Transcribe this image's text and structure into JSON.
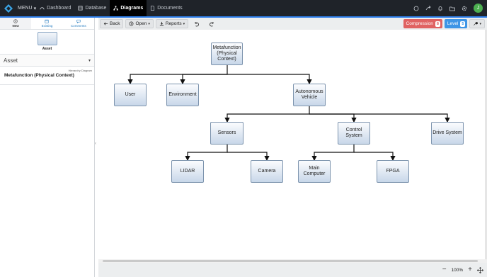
{
  "topbar": {
    "menu_label": "MENU",
    "nav": [
      {
        "label": "Dashboard"
      },
      {
        "label": "Database"
      },
      {
        "label": "Diagrams"
      },
      {
        "label": "Documents"
      }
    ],
    "avatar_initial": "J",
    "icons": [
      "chat-icon",
      "share-icon",
      "bell-icon",
      "folder-icon",
      "gear-icon"
    ]
  },
  "left_panel": {
    "tabs": [
      {
        "label": "New"
      },
      {
        "label": "Existing"
      },
      {
        "label": "Comments"
      }
    ],
    "asset_caption": "Asset",
    "asset_select_value": "Asset",
    "hierarchy_label": "Hierarchy Diagram",
    "diagram_title": "Metafunction (Physical Context)"
  },
  "toolbar": {
    "back_label": "Back",
    "open_label": "Open",
    "reports_label": "Reports",
    "compression_label": "Compression",
    "compression_count": "8",
    "level_label": "Level",
    "level_count": "5"
  },
  "diagram": {
    "nodes": {
      "root": "Metafunction (Physical Context)",
      "user": "User",
      "environment": "Environment",
      "autonomous": "Autonomous Vehicle",
      "sensors": "Sensors",
      "control": "Control System",
      "drive": "Drive System",
      "lidar": "LIDAR",
      "camera": "Camera",
      "main_computer": "Main Computer",
      "fpga": "FPGA"
    }
  },
  "bottom": {
    "zoom": "100%"
  },
  "colors": {
    "topbar_bg": "#1f2329",
    "accent": "#2f80ed",
    "compression": "#e06262",
    "level": "#3d95e6",
    "avatar": "#4caf50"
  }
}
